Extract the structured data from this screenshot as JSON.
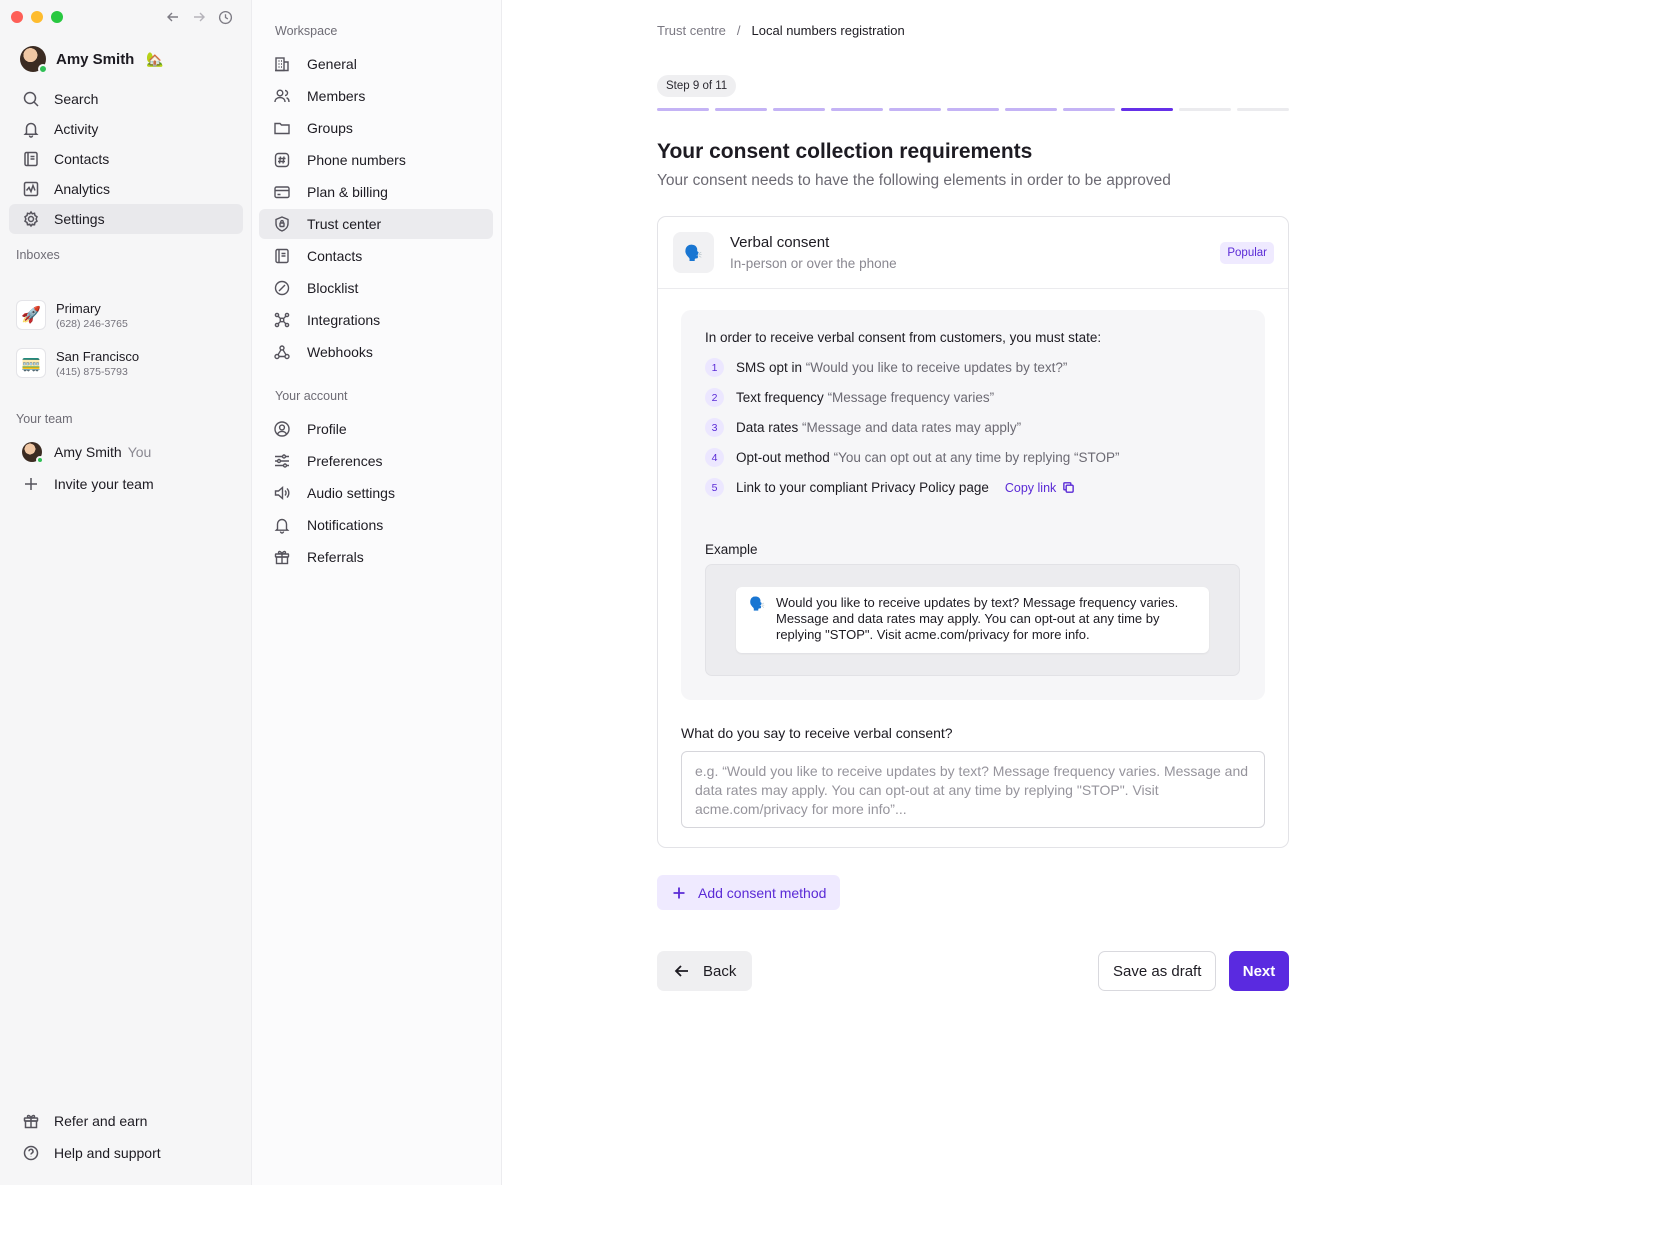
{
  "user": {
    "name": "Amy Smith",
    "emoji": "🏡"
  },
  "nav": {
    "search": "Search",
    "activity": "Activity",
    "contacts": "Contacts",
    "analytics": "Analytics",
    "settings": "Settings"
  },
  "inboxes": {
    "title": "Inboxes",
    "items": [
      {
        "name": "Primary",
        "number": "(628) 246-3765",
        "emoji": "🚀"
      },
      {
        "name": "San Francisco",
        "number": "(415) 875-5793",
        "emoji": "🚃"
      }
    ]
  },
  "team": {
    "title": "Your team",
    "member_name": "Amy Smith",
    "member_tag": "You",
    "invite": "Invite your team"
  },
  "footer": {
    "refer": "Refer and earn",
    "help": "Help and support"
  },
  "workspace": {
    "title": "Workspace",
    "items": [
      "General",
      "Members",
      "Groups",
      "Phone numbers",
      "Plan & billing",
      "Trust center",
      "Contacts",
      "Blocklist",
      "Integrations",
      "Webhooks"
    ]
  },
  "account": {
    "title": "Your account",
    "items": [
      "Profile",
      "Preferences",
      "Audio settings",
      "Notifications",
      "Referrals"
    ]
  },
  "breadcrumb": {
    "parent": "Trust centre",
    "separator": "/",
    "current": "Local numbers registration"
  },
  "progress": {
    "label": "Step 9 of 11",
    "current": 9,
    "total": 11
  },
  "page": {
    "title": "Your consent collection requirements",
    "subtitle": "Your consent needs to have the following elements in order to be approved"
  },
  "method": {
    "icon": "🗣️",
    "title": "Verbal consent",
    "subtitle": "In-person or over the phone",
    "badge": "Popular",
    "intro": "In order to receive verbal consent from customers, you must state:",
    "requirements": [
      {
        "num": "1",
        "label": "SMS opt in",
        "quote": "“Would you like to receive updates by text?”"
      },
      {
        "num": "2",
        "label": "Text frequency",
        "quote": "“Message frequency varies”"
      },
      {
        "num": "3",
        "label": "Data rates",
        "quote": "“Message and data rates may apply”"
      },
      {
        "num": "4",
        "label": "Opt-out method",
        "quote": "“You can opt out at any time by replying “STOP”"
      },
      {
        "num": "5",
        "label": "Link to your compliant Privacy Policy page",
        "quote": ""
      }
    ],
    "copy_link": "Copy link",
    "example_label": "Example",
    "example_icon": "🗣️",
    "example_text": "Would you like to receive updates by text? Message frequency varies. Message and data rates may apply. You can opt-out at any time by replying \"STOP\". Visit acme.com/privacy for more info.",
    "question": "What do you say to receive verbal consent?",
    "placeholder": "e.g. “Would you like to receive updates by text? Message frequency varies. Message and data rates may apply. You can opt-out at any time by replying \"STOP\". Visit acme.com/privacy for more info”..."
  },
  "actions": {
    "add_method": "Add consent method",
    "back": "Back",
    "save_draft": "Save as draft",
    "next": "Next"
  },
  "colors": {
    "accent": "#5a2ae0",
    "accent_soft": "#efeaff",
    "progress_done": "#c4b3f5"
  }
}
